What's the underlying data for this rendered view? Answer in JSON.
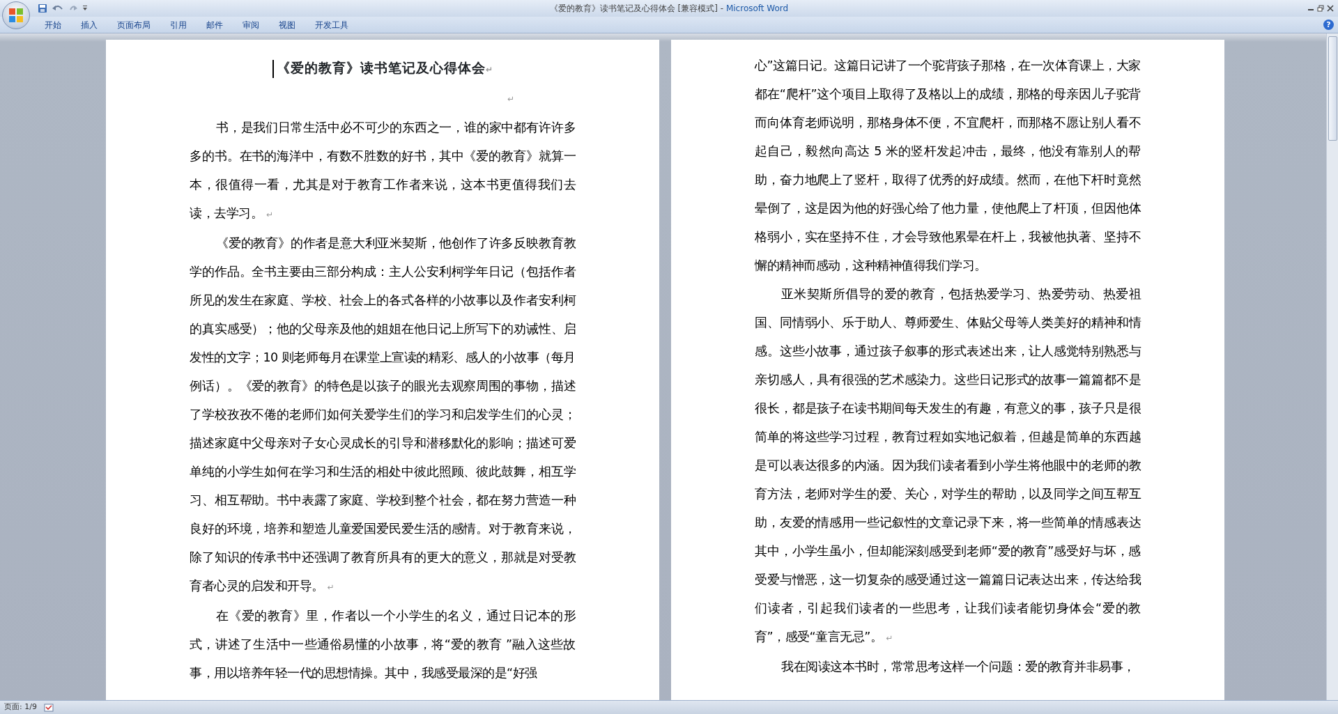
{
  "window": {
    "title": "《爱的教育》读书笔记及心得体会 [兼容模式] - ",
    "app_name": "Microsoft Word"
  },
  "ribbon_tabs": [
    {
      "label": "开始",
      "selected": false
    },
    {
      "label": "插入",
      "selected": false
    },
    {
      "label": "页面布局",
      "selected": false
    },
    {
      "label": "引用",
      "selected": false
    },
    {
      "label": "邮件",
      "selected": false
    },
    {
      "label": "审阅",
      "selected": false
    },
    {
      "label": "视图",
      "selected": false
    },
    {
      "label": "开发工具",
      "selected": false
    }
  ],
  "help": "?",
  "pages": [
    {
      "blocks": [
        {
          "kind": "title",
          "cursor": true,
          "text": "《爱的教育》读书笔记及心得体会",
          "end_mark": "↵"
        },
        {
          "kind": "empty",
          "end_mark": "↵"
        },
        {
          "kind": "paragraph",
          "indent": true,
          "text": "书，是我们日常生活中必不可少的东西之一，谁的家中都有许许多多的书。在书的海洋中，有数不胜数的好书，其中《爱的教育》就算一本，很值得一看，尤其是对于教育工作者来说，这本书更值得我们去读，去学习。",
          "end_mark": "↵"
        },
        {
          "kind": "paragraph",
          "indent": true,
          "text": "《爱的教育》的作者是意大利亚米契斯，他创作了许多反映教育教学的作品。全书主要由三部分构成：主人公安利柯学年日记（包括作者所见的发生在家庭、学校、社会上的各式各样的小故事以及作者安利柯的真实感受）；他的父母亲及他的姐姐在他日记上所写下的劝诫性、启发性的文字；10 则老师每月在课堂上宣读的精彩、感人的小故事（每月例话）。《爱的教育》的特色是以孩子的眼光去观察周围的事物，描述了学校孜孜不倦的老师们如何关爱学生们的学习和启发学生们的心灵；描述家庭中父母亲对子女心灵成长的引导和潜移默化的影响；描述可爱单纯的小学生如何在学习和生活的相处中彼此照顾、彼此鼓舞，相互学习、相互帮助。书中表露了家庭、学校到整个社会，都在努力营造一种良好的环境，培养和塑造儿童爱国爱民爱生活的感情。对于教育来说，除了知识的传承书中还强调了教育所具有的更大的意义，那就是对受教育者心灵的启发和开导。",
          "end_mark": "↵"
        },
        {
          "kind": "paragraph",
          "indent": true,
          "text": "在《爱的教育》里，作者以一个小学生的名义，通过日记本的形式，讲述了生活中一些通俗易懂的小故事，将“爱的教育 ”融入这些故事，用以培养年轻一代的思想情操。其中，我感受最深的是“好强"
        }
      ]
    },
    {
      "blocks": [
        {
          "kind": "paragraph",
          "indent": false,
          "text": "心”这篇日记。这篇日记讲了一个驼背孩子那格，在一次体育课上，大家都在“爬杆”这个项目上取得了及格以上的成绩，那格的母亲因儿子驼背而向体育老师说明，那格身体不便，不宜爬杆，而那格不愿让别人看不起自己，毅然向高达 5 米的竖杆发起冲击，最终，他没有靠别人的帮助，奋力地爬上了竖杆，取得了优秀的好成绩。然而，在他下杆时竟然晕倒了，这是因为他的好强心给了他力量，使他爬上了杆顶，但因他体格弱小，实在坚持不住，才会导致他累晕在杆上，我被他执著、坚持不懈的精神而感动，这种精神值得我们学习。"
        },
        {
          "kind": "paragraph",
          "indent": true,
          "text": "亚米契斯所倡导的爱的教育，包括热爱学习、热爱劳动、热爱祖国、同情弱小、乐于助人、尊师爱生、体贴父母等人类美好的精神和情感。这些小故事，通过孩子叙事的形式表述出来，让人感觉特别熟悉与亲切感人，具有很强的艺术感染力。这些日记形式的故事一篇篇都不是很长，都是孩子在读书期间每天发生的有趣，有意义的事，孩子只是很简单的将这些学习过程，教育过程如实地记叙着，但越是简单的东西越是可以表达很多的内涵。因为我们读者看到小学生将他眼中的老师的教育方法，老师对学生的爱、关心，对学生的帮助，以及同学之间互帮互助，友爱的情感用一些记叙性的文章记录下来，将一些简单的情感表达其中，小学生虽小，但却能深刻感受到老师“爱的教育”感受好与坏，感受爱与憎恶，这一切复杂的感受通过这一篇篇日记表达出来，传达给我们读者，引起我们读者的一些思考，让我们读者能切身体会“爱的教育”，感受“童言无忌”。",
          "end_mark": "↵"
        },
        {
          "kind": "paragraph",
          "indent": true,
          "text": "我在阅读这本书时，常常思考这样一个问题：爱的教育并非易事，"
        }
      ]
    }
  ],
  "status_bar": {
    "page": "页面: 1/9"
  }
}
